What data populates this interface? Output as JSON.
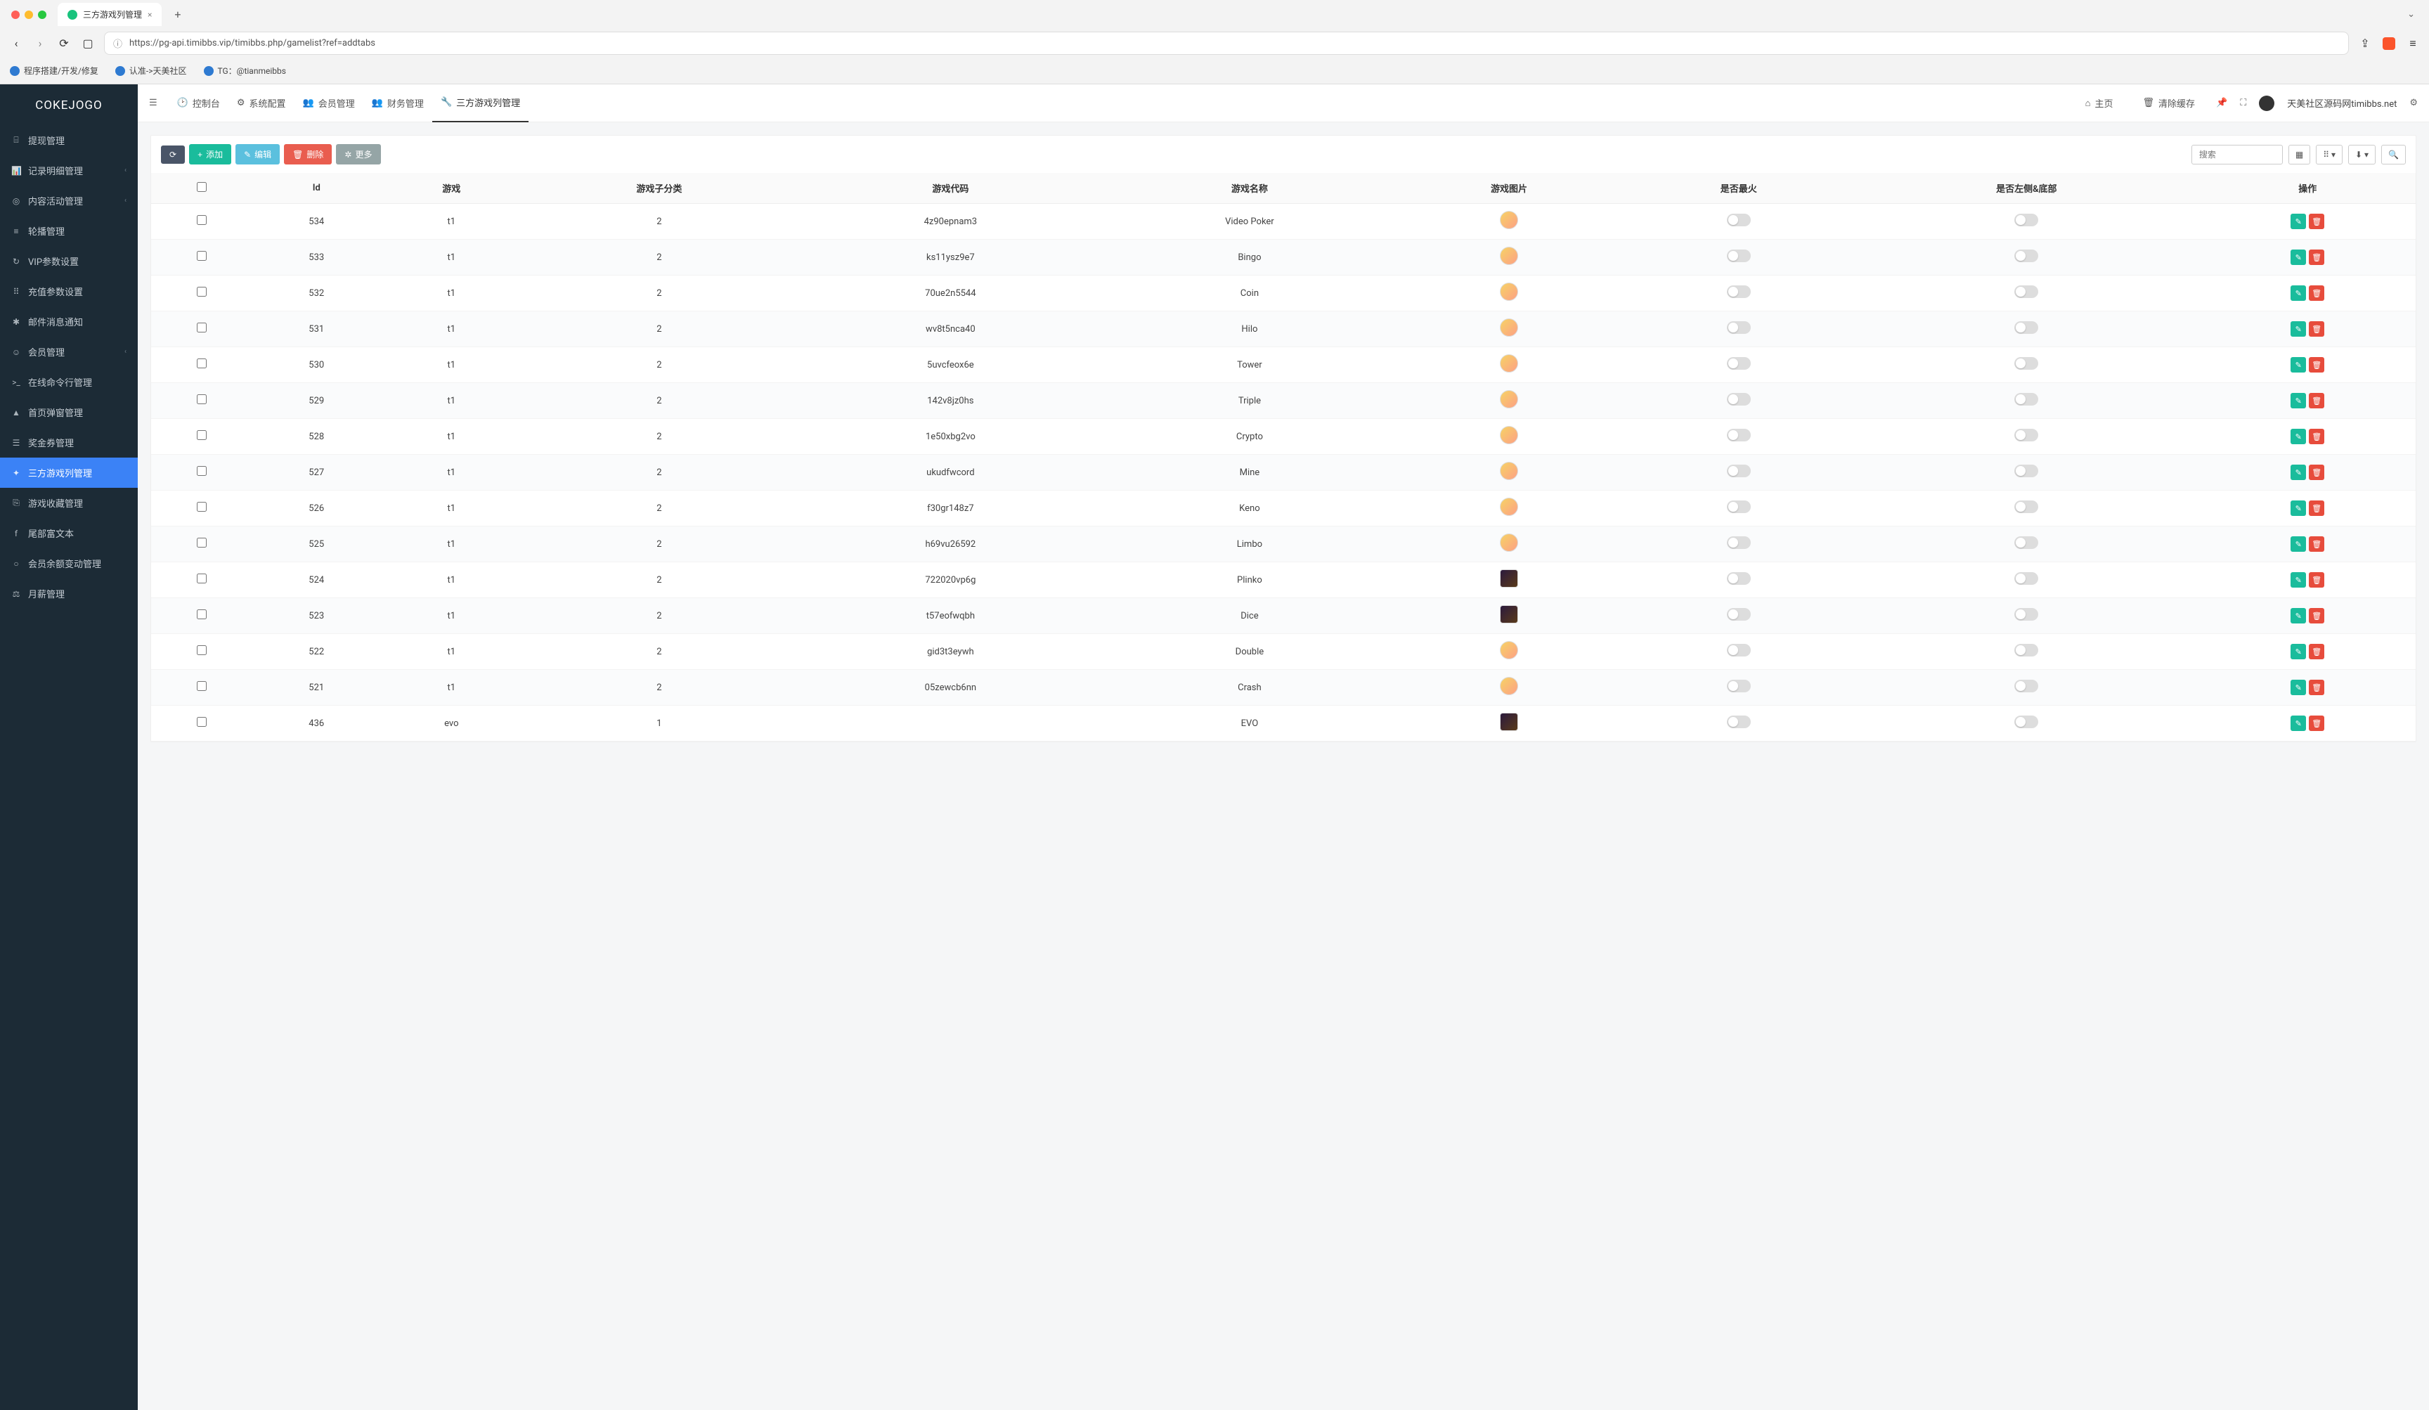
{
  "browser": {
    "tab_title": "三方游戏列管理",
    "url": "https://pg-api.timibbs.vip/timibbs.php/gamelist?ref=addtabs",
    "bookmarks": [
      "程序搭建/开发/修复",
      "认准->天美社区",
      "TG：@tianmeibbs"
    ]
  },
  "app": {
    "logo": "COKEJOGO",
    "sidebar": [
      {
        "icon": "⌸",
        "label": "提现管理"
      },
      {
        "icon": "📊",
        "label": "记录明细管理",
        "expandable": true
      },
      {
        "icon": "◎",
        "label": "内容活动管理",
        "expandable": true
      },
      {
        "icon": "≡",
        "label": "轮播管理"
      },
      {
        "icon": "↻",
        "label": "VIP参数设置"
      },
      {
        "icon": "⠿",
        "label": "充值参数设置"
      },
      {
        "icon": "✱",
        "label": "邮件消息通知"
      },
      {
        "icon": "☺",
        "label": "会员管理",
        "expandable": true
      },
      {
        "icon": ">_",
        "label": "在线命令行管理"
      },
      {
        "icon": "▲",
        "label": "首页弹窗管理"
      },
      {
        "icon": "☰",
        "label": "奖金券管理"
      },
      {
        "icon": "✦",
        "label": "三方游戏列管理",
        "active": true
      },
      {
        "icon": "⎘",
        "label": "游戏收藏管理"
      },
      {
        "icon": "f",
        "label": "尾部富文本"
      },
      {
        "icon": "○",
        "label": "会员余额变动管理"
      },
      {
        "icon": "⚖",
        "label": "月薪管理"
      }
    ],
    "topnav": [
      {
        "icon": "🕑",
        "label": "控制台"
      },
      {
        "icon": "⚙",
        "label": "系统配置"
      },
      {
        "icon": "👥",
        "label": "会员管理"
      },
      {
        "icon": "👥",
        "label": "财务管理"
      },
      {
        "icon": "🔧",
        "label": "三方游戏列管理",
        "active": true
      }
    ],
    "topright": {
      "home": "主页",
      "clear_cache": "清除缓存",
      "username": "天美社区源码网timibbs.net"
    },
    "toolbar": {
      "add": "添加",
      "edit": "编辑",
      "delete": "删除",
      "more": "更多",
      "search_placeholder": "搜索"
    },
    "columns": [
      "",
      "Id",
      "游戏",
      "游戏子分类",
      "游戏代码",
      "游戏名称",
      "游戏图片",
      "是否最火",
      "是否左侧&底部",
      "操作"
    ],
    "rows": [
      {
        "id": "534",
        "game": "t1",
        "sub": "2",
        "code": "4z90epnam3",
        "name": "Video Poker",
        "img": "round"
      },
      {
        "id": "533",
        "game": "t1",
        "sub": "2",
        "code": "ks11ysz9e7",
        "name": "Bingo",
        "img": "round"
      },
      {
        "id": "532",
        "game": "t1",
        "sub": "2",
        "code": "70ue2n5544",
        "name": "Coin",
        "img": "round"
      },
      {
        "id": "531",
        "game": "t1",
        "sub": "2",
        "code": "wv8t5nca40",
        "name": "Hilo",
        "img": "round"
      },
      {
        "id": "530",
        "game": "t1",
        "sub": "2",
        "code": "5uvcfeox6e",
        "name": "Tower",
        "img": "round"
      },
      {
        "id": "529",
        "game": "t1",
        "sub": "2",
        "code": "142v8jz0hs",
        "name": "Triple",
        "img": "round"
      },
      {
        "id": "528",
        "game": "t1",
        "sub": "2",
        "code": "1e50xbg2vo",
        "name": "Crypto",
        "img": "round"
      },
      {
        "id": "527",
        "game": "t1",
        "sub": "2",
        "code": "ukudfwcord",
        "name": "Mine",
        "img": "round"
      },
      {
        "id": "526",
        "game": "t1",
        "sub": "2",
        "code": "f30gr148z7",
        "name": "Keno",
        "img": "round"
      },
      {
        "id": "525",
        "game": "t1",
        "sub": "2",
        "code": "h69vu26592",
        "name": "Limbo",
        "img": "round"
      },
      {
        "id": "524",
        "game": "t1",
        "sub": "2",
        "code": "722020vp6g",
        "name": "Plinko",
        "img": "square"
      },
      {
        "id": "523",
        "game": "t1",
        "sub": "2",
        "code": "t57eofwqbh",
        "name": "Dice",
        "img": "square"
      },
      {
        "id": "522",
        "game": "t1",
        "sub": "2",
        "code": "gid3t3eywh",
        "name": "Double",
        "img": "round"
      },
      {
        "id": "521",
        "game": "t1",
        "sub": "2",
        "code": "05zewcb6nn",
        "name": "Crash",
        "img": "round"
      },
      {
        "id": "436",
        "game": "evo",
        "sub": "1",
        "code": "",
        "name": "EVO",
        "img": "square"
      }
    ]
  }
}
